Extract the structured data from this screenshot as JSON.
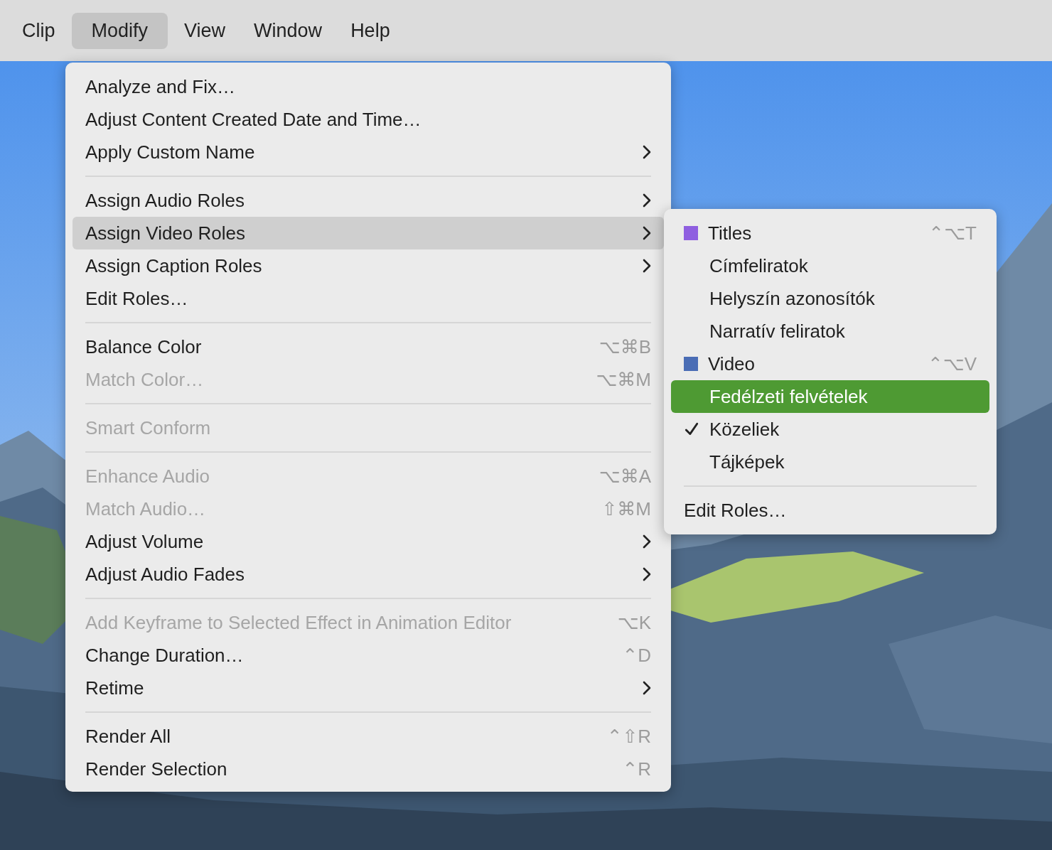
{
  "menubar": [
    {
      "label": "Clip",
      "selected": false
    },
    {
      "label": "Modify",
      "selected": true
    },
    {
      "label": "View",
      "selected": false
    },
    {
      "label": "Window",
      "selected": false
    },
    {
      "label": "Help",
      "selected": false
    }
  ],
  "menu": {
    "sections": [
      [
        {
          "label": "Analyze and Fix…",
          "disabled": false,
          "has_submenu": false,
          "selected": false
        },
        {
          "label": "Adjust Content Created Date and Time…",
          "disabled": false,
          "has_submenu": false,
          "selected": false
        },
        {
          "label": "Apply Custom Name",
          "disabled": false,
          "has_submenu": true,
          "selected": false
        }
      ],
      [
        {
          "label": "Assign Audio Roles",
          "disabled": false,
          "has_submenu": true,
          "selected": false
        },
        {
          "label": "Assign Video Roles",
          "disabled": false,
          "has_submenu": true,
          "selected": true
        },
        {
          "label": "Assign Caption Roles",
          "disabled": false,
          "has_submenu": true,
          "selected": false
        },
        {
          "label": "Edit Roles…",
          "disabled": false,
          "has_submenu": false,
          "selected": false
        }
      ],
      [
        {
          "label": "Balance Color",
          "shortcut": "⌥⌘B",
          "disabled": false,
          "has_submenu": false,
          "selected": false
        },
        {
          "label": "Match Color…",
          "shortcut": "⌥⌘M",
          "disabled": true,
          "has_submenu": false,
          "selected": false
        }
      ],
      [
        {
          "label": "Smart Conform",
          "disabled": true,
          "has_submenu": false,
          "selected": false
        }
      ],
      [
        {
          "label": "Enhance Audio",
          "shortcut": "⌥⌘A",
          "disabled": true,
          "has_submenu": false,
          "selected": false
        },
        {
          "label": "Match Audio…",
          "shortcut": "⇧⌘M",
          "disabled": true,
          "has_submenu": false,
          "selected": false
        },
        {
          "label": "Adjust Volume",
          "disabled": false,
          "has_submenu": true,
          "selected": false
        },
        {
          "label": "Adjust Audio Fades",
          "disabled": false,
          "has_submenu": true,
          "selected": false
        }
      ],
      [
        {
          "label": "Add Keyframe to Selected Effect in Animation Editor",
          "shortcut": "⌥K",
          "disabled": true,
          "has_submenu": false,
          "selected": false
        },
        {
          "label": "Change Duration…",
          "shortcut": "⌃D",
          "disabled": false,
          "has_submenu": false,
          "selected": false
        },
        {
          "label": "Retime",
          "disabled": false,
          "has_submenu": true,
          "selected": false
        }
      ],
      [
        {
          "label": "Render All",
          "shortcut": "⌃⇧R",
          "disabled": false,
          "has_submenu": false,
          "selected": false
        },
        {
          "label": "Render Selection",
          "shortcut": "⌃R",
          "disabled": false,
          "has_submenu": false,
          "selected": false
        }
      ]
    ]
  },
  "submenu": {
    "items": [
      {
        "kind": "role",
        "label": "Titles",
        "color": "#8f5fe0",
        "shortcut": "⌃⌥T",
        "selected": false
      },
      {
        "kind": "subrole",
        "label": "Címfeliratok",
        "checked": false,
        "selected": false
      },
      {
        "kind": "subrole",
        "label": "Helyszín azonosítók",
        "checked": false,
        "selected": false
      },
      {
        "kind": "subrole",
        "label": "Narratív feliratok",
        "checked": false,
        "selected": false
      },
      {
        "kind": "role",
        "label": "Video",
        "color": "#4a6db5",
        "shortcut": "⌃⌥V",
        "selected": false
      },
      {
        "kind": "subrole",
        "label": "Fedélzeti felvételek",
        "checked": false,
        "selected": true
      },
      {
        "kind": "subrole",
        "label": "Közeliek",
        "checked": true,
        "selected": false
      },
      {
        "kind": "subrole",
        "label": "Tájképek",
        "checked": false,
        "selected": false
      },
      {
        "kind": "separator"
      },
      {
        "kind": "action",
        "label": "Edit Roles…",
        "selected": false
      }
    ]
  }
}
